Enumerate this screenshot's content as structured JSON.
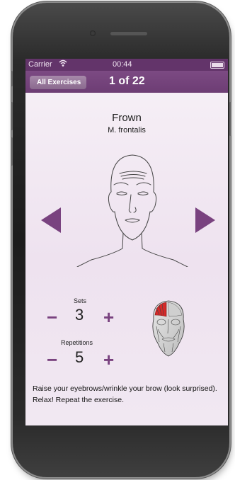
{
  "status_bar": {
    "carrier": "Carrier",
    "time": "00:44"
  },
  "nav": {
    "back_label": "All Exercises",
    "counter": "1 of 22"
  },
  "exercise": {
    "title": "Frown",
    "muscle": "M. frontalis",
    "instructions": "Raise your eyebrows/wrinkle your brow (look surprised). Relax! Repeat the exercise."
  },
  "sets": {
    "label": "Sets",
    "value": "3",
    "minus": "−",
    "plus": "+"
  },
  "repetitions": {
    "label": "Repetitions",
    "value": "5",
    "minus": "−",
    "plus": "+"
  },
  "colors": {
    "accent": "#79427f",
    "nav_bg": "#6d3d74",
    "status_bg": "#63346a",
    "highlight": "#d42a2a"
  },
  "icons": [
    "wifi-icon",
    "battery-icon",
    "prev-arrow-icon",
    "next-arrow-icon"
  ]
}
